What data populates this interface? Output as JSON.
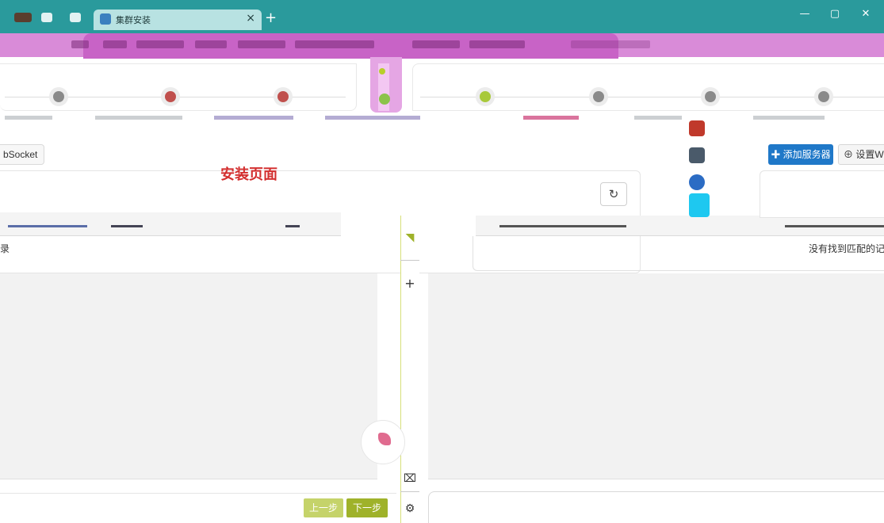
{
  "browser": {
    "tab_title": "集群安装",
    "tab_close": "×",
    "new_tab": "+",
    "minimize": "—",
    "maximize": "▢",
    "close": "✕"
  },
  "wizard": {
    "page_heading": "安装页面",
    "websocket_button": "bSocket",
    "left_steps": [
      {
        "status_color": "#8a8a8a"
      },
      {
        "status_color": "#c0504d"
      },
      {
        "status_color": "#c0504d"
      }
    ],
    "right_steps": [
      {
        "status_color": "#a8c93a"
      },
      {
        "status_color": "#8a8a8a"
      },
      {
        "status_color": "#8a8a8a"
      },
      {
        "status_color": "#8a8a8a"
      }
    ],
    "refresh_icon": "↻",
    "empty_text_left": "录",
    "prev_button": "上一步",
    "next_button": "下一步"
  },
  "servers": {
    "add_button": "✚ 添加服务器",
    "set_button": "⊕ 设置We",
    "empty_text": "没有找到匹配的记录"
  },
  "toolstrip": {
    "items": [
      "◥",
      "+",
      "⌧",
      "⚙"
    ]
  },
  "colors": {
    "titlebar": "#2a9a9c",
    "bookmark_bar": "#d98bd8",
    "accent_blue": "#1f78c8",
    "next_green": "#9fb22a",
    "heading_red": "#d32f2f"
  }
}
